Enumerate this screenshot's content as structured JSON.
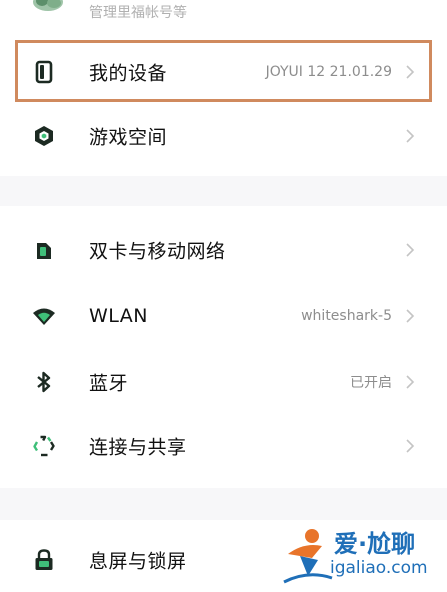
{
  "account_row": {
    "label": "管理里福帐号等",
    "icon": "account-avatar-icon"
  },
  "sections": [
    {
      "items": [
        {
          "label": "我的设备",
          "value": "JOYUI 12 21.01.29",
          "icon": "phone-icon",
          "highlighted": true
        },
        {
          "label": "游戏空间",
          "value": "",
          "icon": "game-space-icon"
        }
      ]
    },
    {
      "items": [
        {
          "label": "双卡与移动网络",
          "value": "",
          "icon": "sim-card-icon"
        },
        {
          "label": "WLAN",
          "value": "whiteshark-5",
          "icon": "wifi-icon"
        },
        {
          "label": "蓝牙",
          "value": "已开启",
          "icon": "bluetooth-icon"
        },
        {
          "label": "连接与共享",
          "value": "",
          "icon": "connection-share-icon"
        }
      ]
    },
    {
      "items": [
        {
          "label": "息屏与锁屏",
          "value": "",
          "icon": "lock-icon"
        }
      ]
    }
  ],
  "watermark": {
    "title": "爱·尬聊",
    "url": "igaliao.com"
  },
  "colors": {
    "highlight_border": "#d08a5e",
    "icon_dark": "#1c2a22",
    "value_gray": "#8d8d8d",
    "watermark_blue": "#1f6fb8",
    "watermark_orange": "#e8742a"
  }
}
